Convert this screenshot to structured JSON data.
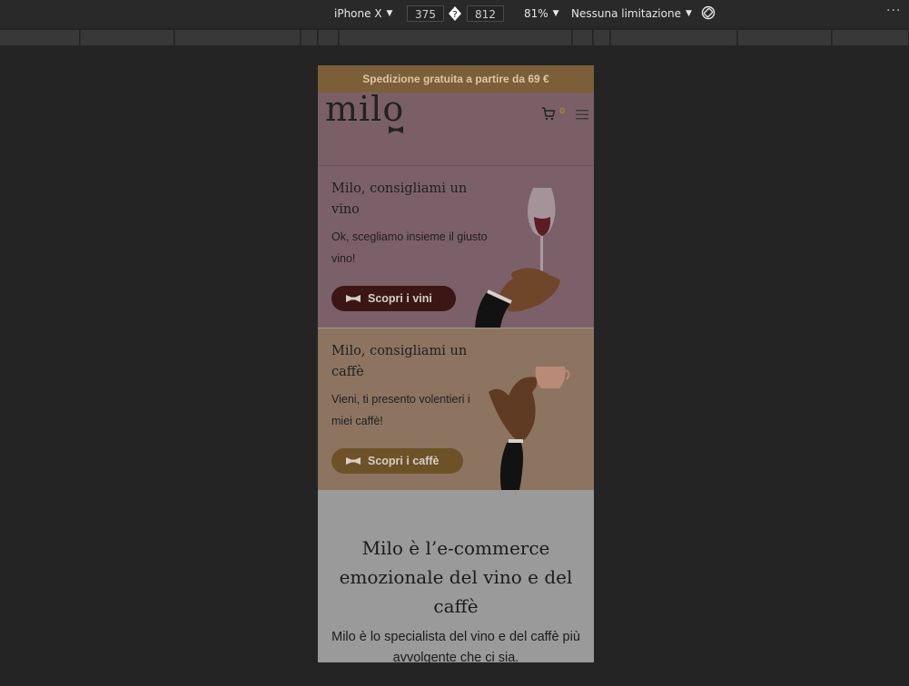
{
  "devtools": {
    "device": "iPhone X",
    "width": "375",
    "height": "812",
    "zoom": "81%",
    "throttling": "Nessuna limitazione",
    "swap_icon": "?",
    "more_icon": "···"
  },
  "site": {
    "banner": "Spedizione gratuita a partire da 69 €",
    "logo": "milo",
    "cart_count": "0"
  },
  "cards": {
    "wine": {
      "title": "Milo, consigliami un vino",
      "text": "Ok, scegliamo insieme il giusto vino!",
      "button": "Scopri i vini"
    },
    "coffee": {
      "title": "Milo, consigliami un caffè",
      "text": "Vieni, ti presento volentieri i miei caffè!",
      "button": "Scopri i caffè"
    }
  },
  "intro": {
    "heading": "Milo è l’e-commerce emozionale del vino e del caffè",
    "text": "Milo è lo specialista del vino e del caffè più avvolgente che ci sia."
  }
}
